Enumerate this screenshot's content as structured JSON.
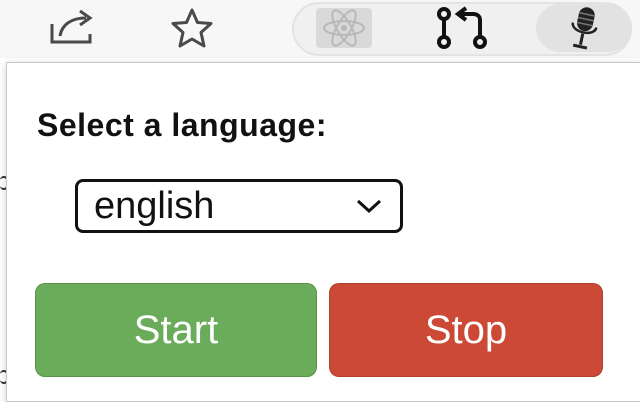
{
  "toolbar": {
    "share_icon": "share-icon",
    "star_icon": "star-icon",
    "react_extension_icon": "react-devtools-icon",
    "git_extension_icon": "git-pull-request-icon",
    "mic_extension_icon": "microphone-icon"
  },
  "popup": {
    "title": "Select a language:",
    "language_select": {
      "selected": "english"
    },
    "start_label": "Start",
    "stop_label": "Stop"
  },
  "colors": {
    "start_button": "#6aac5a",
    "stop_button": "#cc4a35",
    "toolbar_bg": "#f7f7f7"
  }
}
